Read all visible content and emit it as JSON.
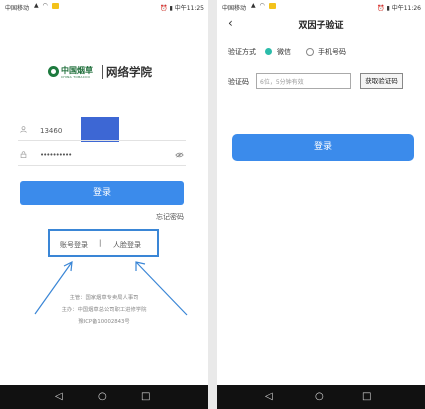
{
  "left_screen": {
    "status": {
      "carrier": "中国移动",
      "time": "中午11:25"
    },
    "logo": {
      "brand_cn": "中国烟草",
      "brand_en": "CHINA TOBACCO",
      "academy": "网络学院"
    },
    "username_value": "13460",
    "password_value": "••••••••••",
    "login_button": "登录",
    "forgot_link": "忘记密码",
    "login_methods": {
      "account": "账号登录",
      "separator": "|",
      "face": "人脸登录"
    },
    "footer": [
      "主管：国家烟草专卖局人事司",
      "主办：中国烟草总公司职工进修学院",
      "豫ICP备10002843号"
    ]
  },
  "right_screen": {
    "status": {
      "carrier": "中国移动",
      "time": "中午11:26"
    },
    "back_icon": "‹",
    "title": "双因子验证",
    "method_label": "验证方式",
    "option_wechat": "微信",
    "option_phone": "手机号码",
    "selected_method": "微信",
    "code_label": "验证码",
    "code_placeholder": "6位，5分钟有效",
    "get_code_button": "获取验证码",
    "login_button": "登录"
  },
  "nav": {
    "back": "◁",
    "home": "○",
    "recent": "□"
  },
  "colors": {
    "primary_button": "#3b8beb",
    "highlight": "#3a86d6",
    "radio_selected": "#2bbcaa",
    "brand_green": "#1a6b36"
  }
}
